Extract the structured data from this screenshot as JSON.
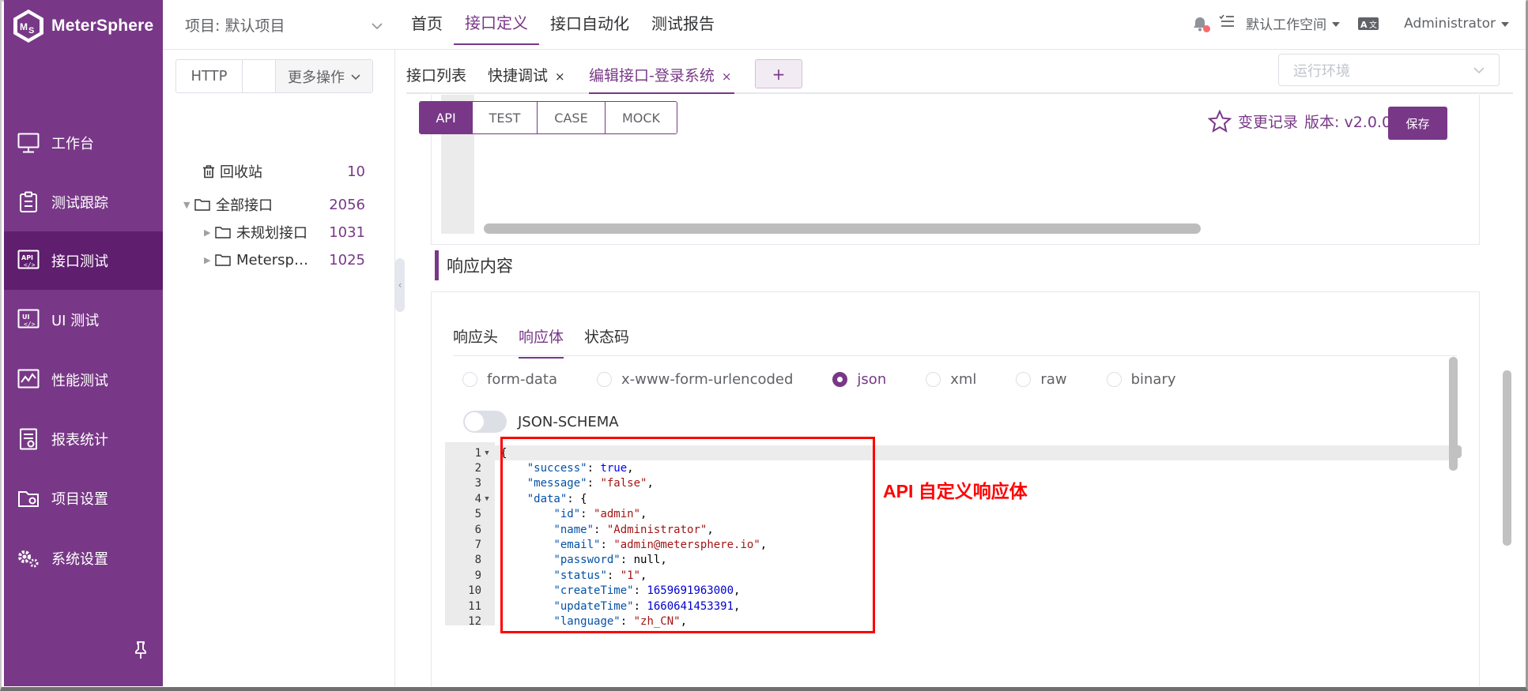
{
  "app": {
    "name": "MeterSphere"
  },
  "sidebar": {
    "items": [
      {
        "label": "工作台",
        "icon": "monitor-icon"
      },
      {
        "label": "测试跟踪",
        "icon": "clipboard-icon"
      },
      {
        "label": "接口测试",
        "icon": "api-icon",
        "active": true
      },
      {
        "label": "UI 测试",
        "icon": "ui-test-icon"
      },
      {
        "label": "性能测试",
        "icon": "performance-chart-icon"
      },
      {
        "label": "报表统计",
        "icon": "report-icon"
      },
      {
        "label": "项目设置",
        "icon": "folder-settings-icon"
      },
      {
        "label": "系统设置",
        "icon": "gears-icon"
      }
    ]
  },
  "header": {
    "project": "项目: 默认项目",
    "nav": [
      "首页",
      "接口定义",
      "接口自动化",
      "测试报告"
    ],
    "active_nav": "接口定义",
    "workspace": "默认工作空间",
    "lang_icon": "translate-icon",
    "user": "Administrator"
  },
  "tree": {
    "protocol": "HTTP",
    "more_ops": "更多操作",
    "trash": {
      "label": "回收站",
      "count": "10"
    },
    "all": {
      "label": "全部接口",
      "count": "2056"
    },
    "children": [
      {
        "label": "未规划接口",
        "count": "1031"
      },
      {
        "label": "Metersp…",
        "count": "1025"
      }
    ]
  },
  "tabs": {
    "items": [
      "接口列表",
      "快捷调试",
      "编辑接口-登录系统"
    ],
    "add": "+",
    "close": "×",
    "env_placeholder": "运行环境"
  },
  "mode": {
    "buttons": [
      "API",
      "TEST",
      "CASE",
      "MOCK"
    ],
    "active": "API"
  },
  "toolbar": {
    "change_log": "变更记录",
    "version": "版本: v2.0.0",
    "save": "保存"
  },
  "response": {
    "title": "响应内容",
    "tabs": [
      "响应头",
      "响应体",
      "状态码"
    ],
    "active_tab": "响应体",
    "body_types": [
      "form-data",
      "x-www-form-urlencoded",
      "json",
      "xml",
      "raw",
      "binary"
    ],
    "selected_type": "json",
    "json_schema_label": "JSON-SCHEMA",
    "json_schema_enabled": false
  },
  "code": {
    "lines": [
      {
        "n": "1",
        "fold": true,
        "text": "{"
      },
      {
        "n": "2",
        "key": "success",
        "value": "true",
        "vt": "b",
        "indent": 1
      },
      {
        "n": "3",
        "key": "message",
        "value": "\"false\"",
        "vt": "s",
        "indent": 1
      },
      {
        "n": "4",
        "fold": true,
        "key": "data",
        "value": "{",
        "vt": "p",
        "indent": 1,
        "nocomma": true
      },
      {
        "n": "5",
        "key": "id",
        "value": "\"admin\"",
        "vt": "s",
        "indent": 2
      },
      {
        "n": "6",
        "key": "name",
        "value": "\"Administrator\"",
        "vt": "s",
        "indent": 2
      },
      {
        "n": "7",
        "key": "email",
        "value": "\"admin@metersphere.io\"",
        "vt": "s",
        "indent": 2
      },
      {
        "n": "8",
        "key": "password",
        "value": "null",
        "vt": "p",
        "indent": 2
      },
      {
        "n": "9",
        "key": "status",
        "value": "\"1\"",
        "vt": "s",
        "indent": 2
      },
      {
        "n": "10",
        "key": "createTime",
        "value": "1659691963000",
        "vt": "n",
        "indent": 2
      },
      {
        "n": "11",
        "key": "updateTime",
        "value": "1660641453391",
        "vt": "n",
        "indent": 2
      },
      {
        "n": "12",
        "key": "language",
        "value": "\"zh_CN\"",
        "vt": "s",
        "indent": 2
      }
    ]
  },
  "annotation": {
    "text": "API 自定义响应体"
  },
  "colors": {
    "brand": "#783887",
    "brand_dark": "#5f1e6e",
    "annotation": "#ff0000"
  }
}
